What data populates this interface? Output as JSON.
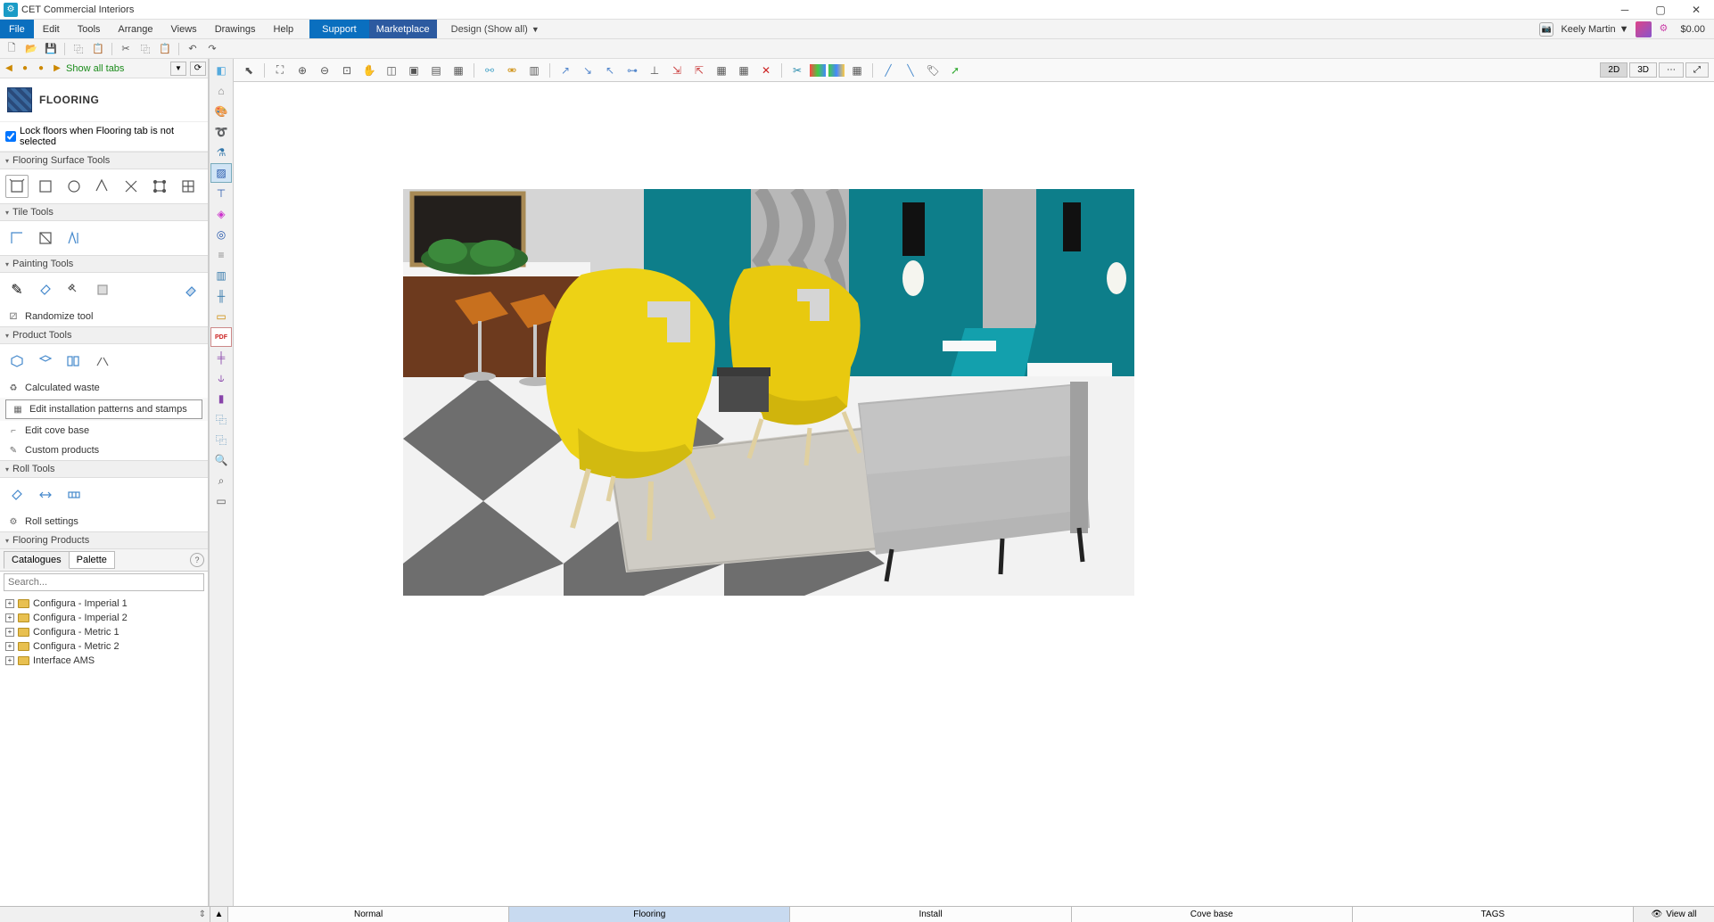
{
  "app": {
    "title": "CET Commercial Interiors",
    "price": "$0.00"
  },
  "menu": {
    "items": [
      "File",
      "Edit",
      "Tools",
      "Arrange",
      "Views",
      "Drawings",
      "Help"
    ],
    "support": "Support",
    "marketplace": "Marketplace",
    "design_pill": "Design (Show all)"
  },
  "user": {
    "name": "Keely Martin"
  },
  "tabs_row": {
    "show_all": "Show all tabs"
  },
  "flooring": {
    "title": "FLOORING",
    "lock_label": "Lock floors when Flooring tab is not selected"
  },
  "panels": {
    "surface": "Flooring Surface Tools",
    "tile": "Tile Tools",
    "painting": "Painting Tools",
    "randomize": "Randomize tool",
    "product": "Product Tools",
    "calc_waste": "Calculated waste",
    "edit_patterns": "Edit installation patterns and stamps",
    "edit_cove": "Edit cove base",
    "custom_products": "Custom products",
    "roll": "Roll Tools",
    "roll_settings": "Roll settings",
    "flooring_products": "Flooring Products"
  },
  "catalog_tabs": {
    "catalogues": "Catalogues",
    "palette": "Palette"
  },
  "search": {
    "placeholder": "Search..."
  },
  "tree": [
    "Configura - Imperial 1",
    "Configura - Imperial 2",
    "Configura - Metric 1",
    "Configura - Metric 2",
    "Interface AMS"
  ],
  "view_toggle": {
    "two_d": "2D",
    "three_d": "3D"
  },
  "bottom_tabs": [
    "Normal",
    "Flooring",
    "Install",
    "Cove base",
    "TAGS"
  ],
  "bottom_view_all": "View all",
  "icon_strip_pdf": "PDF"
}
